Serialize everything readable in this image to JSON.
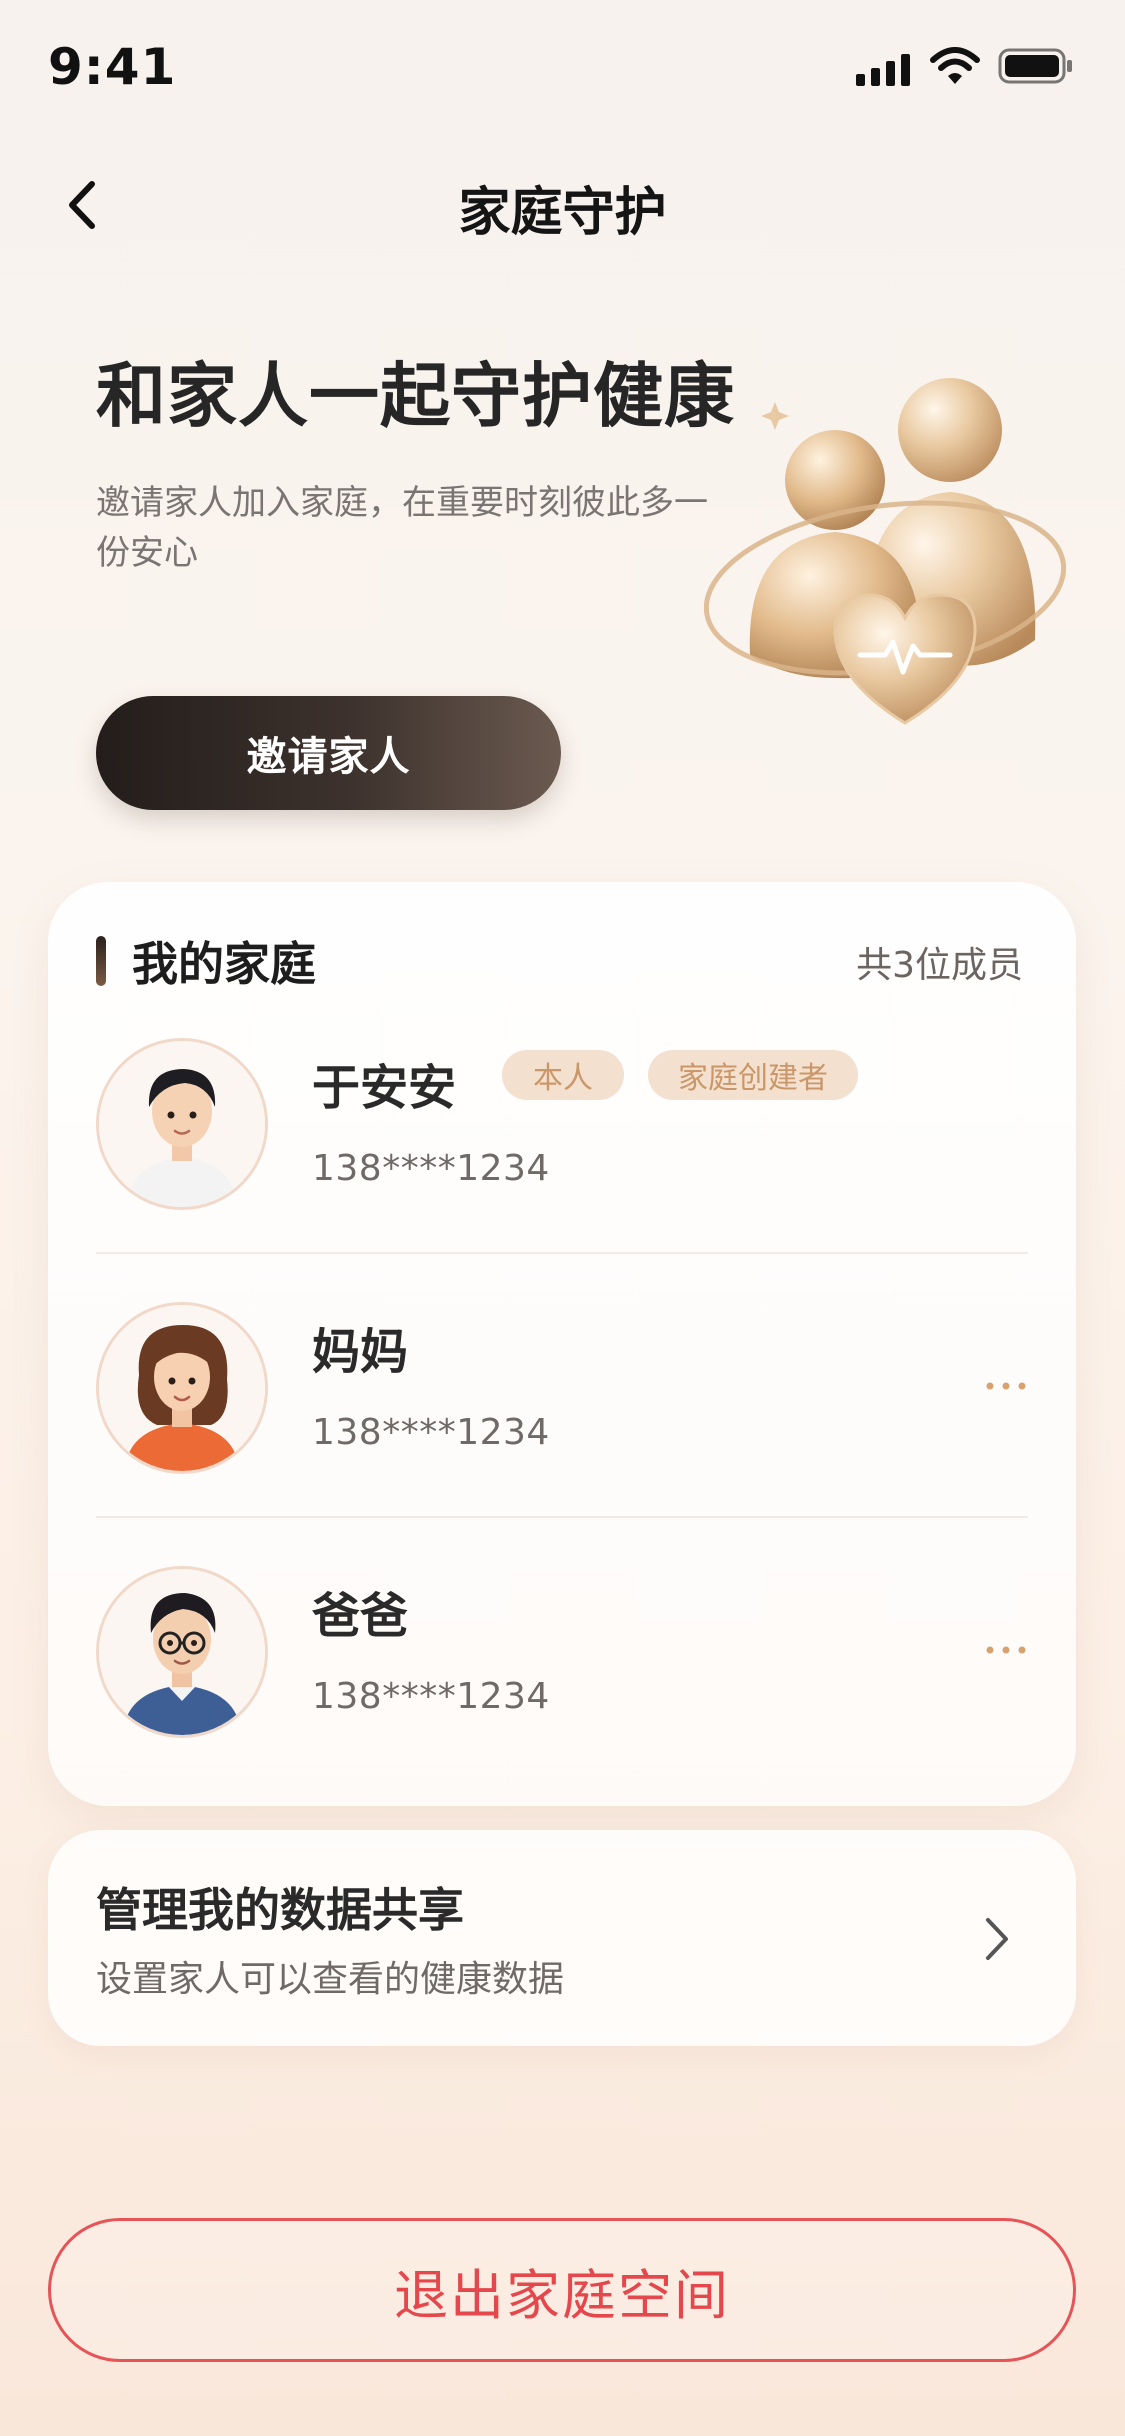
{
  "status_bar": {
    "time": "9:41"
  },
  "nav": {
    "title": "家庭守护"
  },
  "hero": {
    "title": "和家人一起守护健康",
    "subtitle": "邀请家人加入家庭，在重要时刻彼此多一份安心",
    "invite_label": "邀请家人"
  },
  "family": {
    "section_title": "我的家庭",
    "member_count": "共3位成员",
    "members": [
      {
        "name": "于安安",
        "phone": "138****1234",
        "tags": [
          "本人",
          "家庭创建者"
        ]
      },
      {
        "name": "妈妈",
        "phone": "138****1234"
      },
      {
        "name": "爸爸",
        "phone": "138****1234"
      }
    ]
  },
  "data_share": {
    "title": "管理我的数据共享",
    "subtitle": "设置家人可以查看的健康数据"
  },
  "exit": {
    "label": "退出家庭空间"
  },
  "colors": {
    "accent_gold": "#c99769",
    "danger": "#e4474c",
    "tag_bg": "#f4e0cf"
  },
  "icons": [
    "signal-icon",
    "wifi-icon",
    "battery-icon",
    "back-chevron-icon",
    "family-heart-illustration",
    "more-dots-icon",
    "chevron-right-icon"
  ]
}
